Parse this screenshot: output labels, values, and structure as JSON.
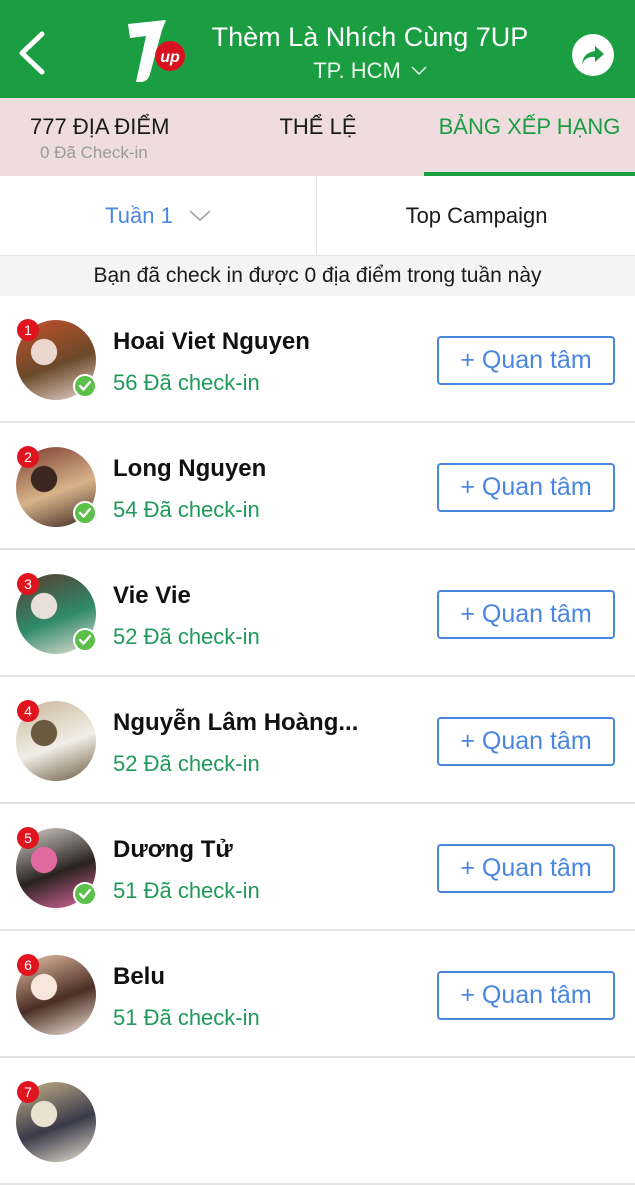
{
  "header": {
    "title": "Thèm Là Nhích Cùng 7UP",
    "city": "TP. HCM",
    "logo_text": "7up",
    "brand_color": "#1b9e42"
  },
  "tabs": [
    {
      "label": "777 ĐỊA ĐIỂM",
      "sub": "0 Đã Check-in",
      "active": false
    },
    {
      "label": "THỂ LỆ",
      "active": false
    },
    {
      "label": "BẢNG XẾP HẠNG",
      "active": true
    }
  ],
  "filters": {
    "week": "Tuần 1",
    "campaign": "Top Campaign"
  },
  "notice": "Bạn đã check in được 0 địa điểm trong tuần này",
  "follow_label": "+ Quan tâm",
  "leaderboard": [
    {
      "rank": "1",
      "name": "Hoai Viet Nguyen",
      "checkins": "56 Đã check-in",
      "verified": true,
      "avatar_colors": [
        "#c2502b",
        "#6b4a2a",
        "#e9d7d0"
      ]
    },
    {
      "rank": "2",
      "name": "Long Nguyen",
      "checkins": "54 Đã check-in",
      "verified": true,
      "avatar_colors": [
        "#7a3b2e",
        "#d8b48a",
        "#3b2620"
      ]
    },
    {
      "rank": "3",
      "name": "Vie Vie",
      "checkins": "52 Đã check-in",
      "verified": true,
      "avatar_colors": [
        "#5a3a2e",
        "#2f8a6a",
        "#e8e0d8"
      ]
    },
    {
      "rank": "4",
      "name": "Nguyễn Lâm Hoàng...",
      "checkins": "52 Đã check-in",
      "verified": false,
      "avatar_colors": [
        "#c7b79a",
        "#f2ede6",
        "#6a5a40"
      ]
    },
    {
      "rank": "5",
      "name": "Dương Tử",
      "checkins": "51 Đã check-in",
      "verified": true,
      "avatar_colors": [
        "#d9d3cc",
        "#2a2220",
        "#e06aa0"
      ]
    },
    {
      "rank": "6",
      "name": "Belu",
      "checkins": "51 Đã check-in",
      "verified": false,
      "avatar_colors": [
        "#e8c2a8",
        "#4a2e24",
        "#f6e6dc"
      ]
    },
    {
      "rank": "7",
      "name": "",
      "checkins": "",
      "verified": false,
      "avatar_colors": [
        "#c9b48a",
        "#3a3a4a",
        "#e9e2d0"
      ]
    }
  ]
}
